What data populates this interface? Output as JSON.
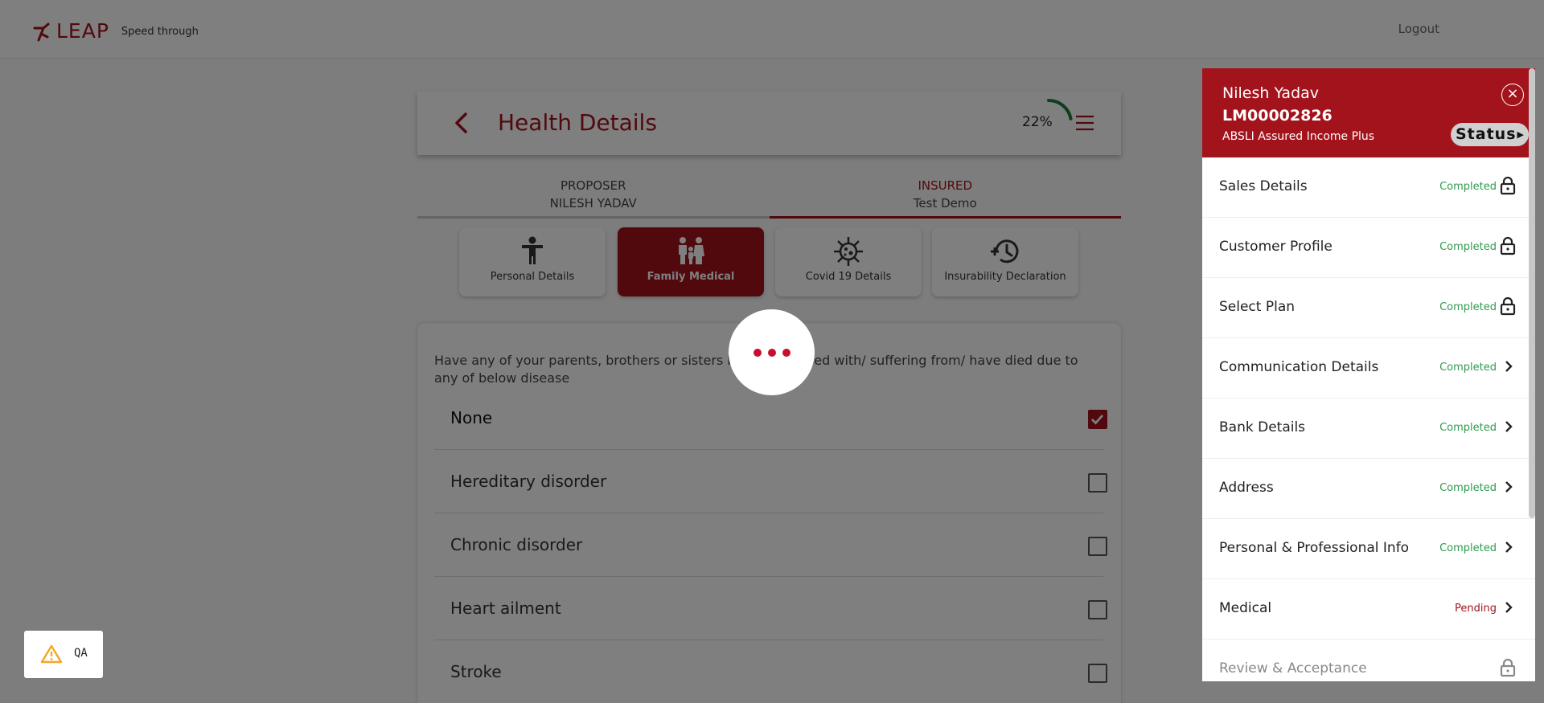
{
  "header": {
    "logo_text": "LEAP",
    "tagline": "Speed through",
    "logout": "Logout"
  },
  "page": {
    "title": "Health Details",
    "progress_text": "22%",
    "progress_value": 0.22
  },
  "tabs": [
    {
      "role": "PROPOSER",
      "name": "NILESH YADAV",
      "active": false
    },
    {
      "role": "INSURED",
      "name": "Test Demo",
      "active": true
    }
  ],
  "subtabs": [
    {
      "label": "Personal Details",
      "icon": "person-icon",
      "active": false
    },
    {
      "label": "Family Medical",
      "icon": "family-icon",
      "active": true
    },
    {
      "label": "Covid 19 Details",
      "icon": "virus-icon",
      "active": false
    },
    {
      "label": "Insurability Declaration",
      "icon": "history-icon",
      "active": false
    }
  ],
  "question": {
    "text": "Have any of your parents, brothers or sisters been diagnosed with/ suffering from/ have died due to any of below disease",
    "options": [
      {
        "label": "None",
        "checked": true
      },
      {
        "label": "Hereditary disorder",
        "checked": false
      },
      {
        "label": "Chronic disorder",
        "checked": false
      },
      {
        "label": "Heart ailment",
        "checked": false
      },
      {
        "label": "Stroke",
        "checked": false
      }
    ]
  },
  "panel": {
    "name": "Nilesh Yadav",
    "lead_id": "LM00002826",
    "plan": "ABSLI Assured Income Plus",
    "status_button": "Status",
    "items": [
      {
        "label": "Sales Details",
        "status": "Completed",
        "icon": "lock-icon"
      },
      {
        "label": "Customer Profile",
        "status": "Completed",
        "icon": "lock-icon"
      },
      {
        "label": "Select Plan",
        "status": "Completed",
        "icon": "lock-icon"
      },
      {
        "label": "Communication Details",
        "status": "Completed",
        "icon": "chevron-right-icon"
      },
      {
        "label": "Bank Details",
        "status": "Completed",
        "icon": "chevron-right-icon"
      },
      {
        "label": "Address",
        "status": "Completed",
        "icon": "chevron-right-icon"
      },
      {
        "label": "Personal & Professional Info",
        "status": "Completed",
        "icon": "chevron-right-icon"
      },
      {
        "label": "Medical",
        "status": "Pending",
        "icon": "chevron-right-icon"
      },
      {
        "label": "Review & Acceptance",
        "status": "",
        "icon": "lock-icon"
      }
    ]
  },
  "qa_badge": {
    "text": "QA"
  },
  "colors": {
    "brand": "#a3131c",
    "completed": "#2e9b4f",
    "progress": "#1e7a3c",
    "warning": "#f5a623"
  }
}
